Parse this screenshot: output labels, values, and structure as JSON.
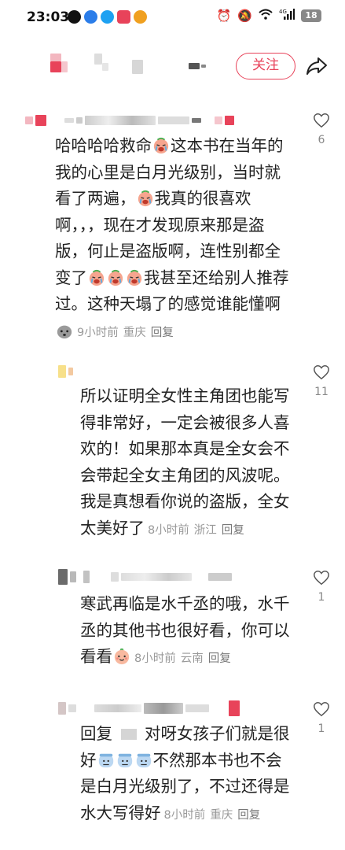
{
  "status_bar": {
    "time": "23:03",
    "battery": "18",
    "network": "4G"
  },
  "header": {
    "follow_label": "关注",
    "share_icon": "share-arrow-icon"
  },
  "comments": [
    {
      "text_parts": [
        {
          "t": "哈哈哈哈救命"
        },
        {
          "e": "crying-face"
        },
        {
          "t": "这本书在当年的我的心里是白月光级别，当时就看了两遍，"
        },
        {
          "e": "crying-face"
        },
        {
          "t": "我真的很喜欢啊，，，现在才发现原来那是盗版，何止是盗版啊，连性别都全变了"
        },
        {
          "e": "crying-face"
        },
        {
          "e": "crying-face"
        },
        {
          "e": "crying-face"
        },
        {
          "t": "我甚至还给别人推荐过。这种天塌了的感觉谁能懂啊"
        },
        {
          "e": "gray-face"
        }
      ],
      "time": "9小时前",
      "location": "重庆",
      "reply": "回复",
      "likes": "6"
    },
    {
      "text_parts": [
        {
          "t": "所以证明全女性主角团也能写得非常好，一定会被很多人喜欢的！如果那本真是全女会不会带起全女主角团的风波呢。我是真想看你说的盗版，全女太美好了"
        }
      ],
      "time": "8小时前",
      "location": "浙江",
      "reply": "回复",
      "likes": "11"
    },
    {
      "text_parts": [
        {
          "t": "寒武再临是水千丞的哦，水千丞的其他书也很好看，你可以看看"
        },
        {
          "e": "peach-face"
        }
      ],
      "time": "8小时前",
      "location": "云南",
      "reply": "回复",
      "likes": "1"
    },
    {
      "text_parts": [
        {
          "t": "回复 "
        },
        {
          "b": "redacted"
        },
        {
          "t": " 对呀女孩子们就是很好"
        },
        {
          "e": "cold-face"
        },
        {
          "e": "cold-face"
        },
        {
          "e": "cold-face"
        },
        {
          "t": "不然那本书也不会是白月光级别了，不过还得是水大写得好"
        }
      ],
      "time": "8小时前",
      "location": "重庆",
      "reply": "回复",
      "likes": "1"
    }
  ],
  "colors": {
    "accent": "#e8435a",
    "meta": "#999999"
  }
}
